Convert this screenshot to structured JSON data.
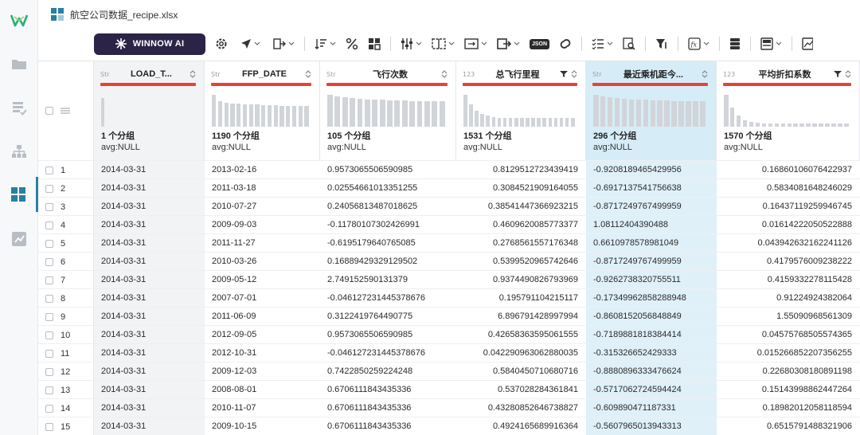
{
  "window": {
    "title": "航空公司数据_recipe.xlsx"
  },
  "sidebar": {
    "items": [
      {
        "icon": "logo-icon"
      },
      {
        "icon": "folder-icon"
      },
      {
        "icon": "data-check-icon"
      },
      {
        "icon": "hierarchy-icon"
      },
      {
        "icon": "dashboard-icon",
        "active": true
      },
      {
        "icon": "chart-box-icon"
      }
    ]
  },
  "toolbar": {
    "ai_label": "WINNOW AI",
    "json_label": "JSON"
  },
  "columns": [
    {
      "type": "Str",
      "name": "LOAD_T...",
      "groups": "1 个分组",
      "avg": "avg:NULL",
      "style": "dim",
      "filter": false,
      "hist": [
        0.9
      ]
    },
    {
      "type": "Str",
      "name": "FFP_DATE",
      "groups": "1190 个分组",
      "avg": "avg:NULL",
      "style": "",
      "filter": false,
      "hist": [
        1,
        0.8,
        0.75,
        0.72,
        0.72,
        0.7,
        0.7,
        0.7,
        0.68,
        0.68,
        0.68,
        0.66,
        0.66,
        0.66,
        0.65,
        0.65
      ]
    },
    {
      "type": "Str",
      "name": "飞行次数",
      "groups": "105 个分组",
      "avg": "avg:NULL",
      "style": "",
      "filter": false,
      "hist": [
        1,
        0.95,
        0.92,
        0.9,
        0.88,
        0.86,
        0.85,
        0.84,
        0.83,
        0.82,
        0.82,
        0.81,
        0.8,
        0.8,
        0.8,
        0.8
      ]
    },
    {
      "type": "123",
      "name": "总飞行里程",
      "groups": "1531 个分组",
      "avg": "avg:NULL",
      "style": "",
      "filter": true,
      "hist": [
        1,
        0.7,
        0.5,
        0.4,
        0.35,
        0.3,
        0.28,
        0.28,
        0.28,
        0.27,
        0.27,
        0.27,
        0.27,
        0.27,
        0.27,
        0.27,
        0.27,
        0.27,
        0.27,
        0.27
      ]
    },
    {
      "type": "Str",
      "name": "最近乘机距今...",
      "groups": "296 个分组",
      "avg": "avg:NULL",
      "style": "sel",
      "filter": false,
      "hist": [
        1,
        0.95,
        0.92,
        0.9,
        0.88,
        0.86,
        0.85,
        0.84,
        0.83,
        0.82,
        0.82,
        0.81,
        0.8,
        0.8,
        0.8,
        0.8
      ]
    },
    {
      "type": "123",
      "name": "平均折扣系数",
      "groups": "1570 个分组",
      "avg": "avg:NULL",
      "style": "",
      "filter": true,
      "hist": [
        1,
        0.6,
        0.35,
        0.2,
        0.15,
        0.12,
        0.1,
        0.1,
        0.09,
        0.09,
        0.09,
        0.09,
        0.09,
        0.09,
        0.09,
        0.09,
        0.09,
        0.09,
        0.09,
        0.09
      ]
    }
  ],
  "rows": [
    [
      "1",
      "2014-03-31",
      "2013-02-16",
      "0.9573065506590985",
      "0.8129512723439419",
      "-0.9208189465429956",
      "0.16860106076422937"
    ],
    [
      "2",
      "2014-03-31",
      "2011-03-18",
      "0.02554661013351255",
      "0.3084521909164055",
      "-0.6917137541756638",
      "0.5834081648246029"
    ],
    [
      "3",
      "2014-03-31",
      "2010-07-27",
      "0.24056813487018625",
      "0.38541447366923215",
      "-0.8717249767499959",
      "0.16437119259946745"
    ],
    [
      "4",
      "2014-03-31",
      "2009-09-03",
      "-0.11780107302426991",
      "0.4609620085773377",
      "1.08112404390488",
      "0.01614222050522888"
    ],
    [
      "5",
      "2014-03-31",
      "2011-11-27",
      "-0.6195179640765085",
      "0.2768561557176348",
      "0.6610978578981049",
      "0.043942632162241126"
    ],
    [
      "6",
      "2014-03-31",
      "2010-03-26",
      "0.16889429329129502",
      "0.5399520965742646",
      "-0.8717249767499959",
      "0.4179576009238222"
    ],
    [
      "7",
      "2014-03-31",
      "2009-05-12",
      "2.749152590131379",
      "0.9374490826793969",
      "-0.9262738320755511",
      "0.4159332278115428"
    ],
    [
      "8",
      "2014-03-31",
      "2007-07-01",
      "-0.046127231445378676",
      "0.19579110421511​7",
      "-0.17349962858288948",
      "0.91224924382064"
    ],
    [
      "9",
      "2014-03-31",
      "2011-06-09",
      "0.3122419764490775",
      "6.896791428997994",
      "-0.8608152056848849",
      "1.55090968561309"
    ],
    [
      "10",
      "2014-03-31",
      "2012-09-05",
      "0.9573065506590985",
      "0.42658363595061555",
      "-0.7189881818384414",
      "0.04575768505574365"
    ],
    [
      "11",
      "2014-03-31",
      "2012-10-31",
      "-0.046127231445378676",
      "0.042290963062880035",
      "-0.315326652429333",
      "0.015266852207356255"
    ],
    [
      "12",
      "2014-03-31",
      "2009-12-03",
      "0.7422850259224248",
      "0.5840450710680716",
      "-0.8880896333476624",
      "0.22680308180891198"
    ],
    [
      "13",
      "2014-03-31",
      "2008-08-01",
      "0.6706111843435336",
      "0.537028284361841",
      "-0.5717062724594424",
      "0.15143998862447264"
    ],
    [
      "14",
      "2014-03-31",
      "2010-11-07",
      "0.6706111843435336",
      "0.43280852646738827",
      "-0.609890471187331",
      "0.1898201205811859​4"
    ],
    [
      "15",
      "2014-03-31",
      "2009-10-15",
      "0.6706111843435336",
      "0.4924165689916364",
      "-0.5607965013943313",
      "0.6515791488321906"
    ]
  ]
}
